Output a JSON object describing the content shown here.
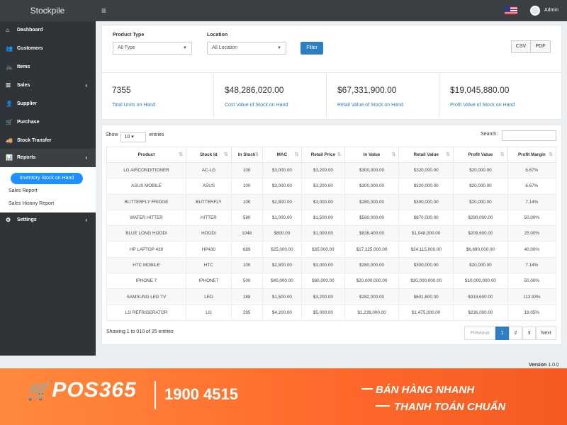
{
  "app": {
    "brand": "Stockpile",
    "user": "Admin"
  },
  "icons": {
    "menu": "≡",
    "flag": "us-flag-icon",
    "avatar": "user-avatar-icon"
  },
  "sidebar": {
    "items": [
      {
        "label": "Dashboard",
        "icon": "⌂"
      },
      {
        "label": "Customers",
        "icon": "👥"
      },
      {
        "label": "Items",
        "icon": "🚲"
      },
      {
        "label": "Sales",
        "icon": "☰",
        "chevron": "‹"
      },
      {
        "label": "Supplier",
        "icon": "👤"
      },
      {
        "label": "Purchase",
        "icon": "🛒"
      },
      {
        "label": "Stock Transfer",
        "icon": "🚚"
      },
      {
        "label": "Reports",
        "icon": "📊",
        "chevron": "‹"
      },
      {
        "label": "Settings",
        "icon": "⚙",
        "chevron": "‹"
      }
    ],
    "reports_sub": {
      "active": "Inventory Stock on Hand",
      "links": [
        "Sales Report",
        "Sales History Report"
      ]
    }
  },
  "filters": {
    "product_type_label": "Product Type",
    "product_type_value": "All Type",
    "location_label": "Location",
    "location_value": "All Location",
    "filter_button": "Filter",
    "csv": "CSV",
    "pdf": "PDF"
  },
  "stats": [
    {
      "value": "7355",
      "label": "Total Units on Hand"
    },
    {
      "value": "$48,286,020.00",
      "label": "Cost Value of Stock on Hand"
    },
    {
      "value": "$67,331,900.00",
      "label": "Retail Value of Stock on Hand"
    },
    {
      "value": "$19,045,880.00",
      "label": "Profit Value of Stock on Hand"
    }
  ],
  "table": {
    "show_label": "Show",
    "entries_value": "10",
    "entries_label": "entries",
    "search_label": "Search:",
    "columns": [
      "Product",
      "Stock Id",
      "In Stock",
      "MAC",
      "Retail Price",
      "In Value",
      "Retail Value",
      "Profit Value",
      "Profit Margin"
    ],
    "rows": [
      [
        "LG AIRCONDITIONER",
        "AC-LG",
        "100",
        "$3,000.00",
        "$3,200.00",
        "$300,000.00",
        "$320,000.00",
        "$20,000.00",
        "6.67%"
      ],
      [
        "ASUS MOBILE",
        "ASUS",
        "100",
        "$3,000.00",
        "$3,200.00",
        "$300,000.00",
        "$320,000.00",
        "$20,000.00",
        "6.67%"
      ],
      [
        "BUTTERFLY FRIDGE",
        "BUTTERFLY",
        "100",
        "$2,800.00",
        "$3,000.00",
        "$280,000.00",
        "$300,000.00",
        "$20,000.00",
        "7.14%"
      ],
      [
        "WATER HITTER",
        "HITTER",
        "580",
        "$1,000.00",
        "$1,500.00",
        "$580,000.00",
        "$870,000.00",
        "$290,000.00",
        "50.00%"
      ],
      [
        "BLUE LONG HOODI",
        "HOODI",
        "1048",
        "$800.00",
        "$1,000.00",
        "$838,400.00",
        "$1,048,000.00",
        "$209,600.00",
        "25.00%"
      ],
      [
        "HP LAPTOP 430",
        "HP430",
        "689",
        "$25,000.00",
        "$35,000.00",
        "$17,225,000.00",
        "$24,115,000.00",
        "$6,890,000.00",
        "40.00%"
      ],
      [
        "HTC MOBILE",
        "HTC",
        "100",
        "$2,800.00",
        "$3,000.00",
        "$280,000.00",
        "$300,000.00",
        "$20,000.00",
        "7.14%"
      ],
      [
        "IPHONE 7",
        "IPHONE7",
        "500",
        "$40,000.00",
        "$60,000.00",
        "$20,000,000.00",
        "$30,000,000.00",
        "$10,000,000.00",
        "50.00%"
      ],
      [
        "SAMSUNG LED TV",
        "LED",
        "188",
        "$1,500.00",
        "$3,200.00",
        "$282,000.00",
        "$601,600.00",
        "$319,600.00",
        "113.33%"
      ],
      [
        "LG REFRIGERATOR",
        "LG",
        "295",
        "$4,200.00",
        "$5,000.00",
        "$1,239,000.00",
        "$1,475,000.00",
        "$236,000.00",
        "19.05%"
      ]
    ],
    "showing": "Showing 1 to 010 of 25 entries",
    "pager": {
      "prev": "Previous",
      "pages": [
        "1",
        "2",
        "3"
      ],
      "next": "Next"
    }
  },
  "footer": {
    "version_label": "Version",
    "version_value": "1.0.0"
  },
  "banner": {
    "logo": "POS365",
    "phone": "1900 4515",
    "slogan1": "BÁN HÀNG NHANH",
    "slogan2": "THANH TOÁN CHUẨN"
  },
  "colors": {
    "accent": "#2e7fc1",
    "sidebar": "#2f3438",
    "active_pill": "#1e90ff",
    "banner": "#ff6b2c"
  }
}
